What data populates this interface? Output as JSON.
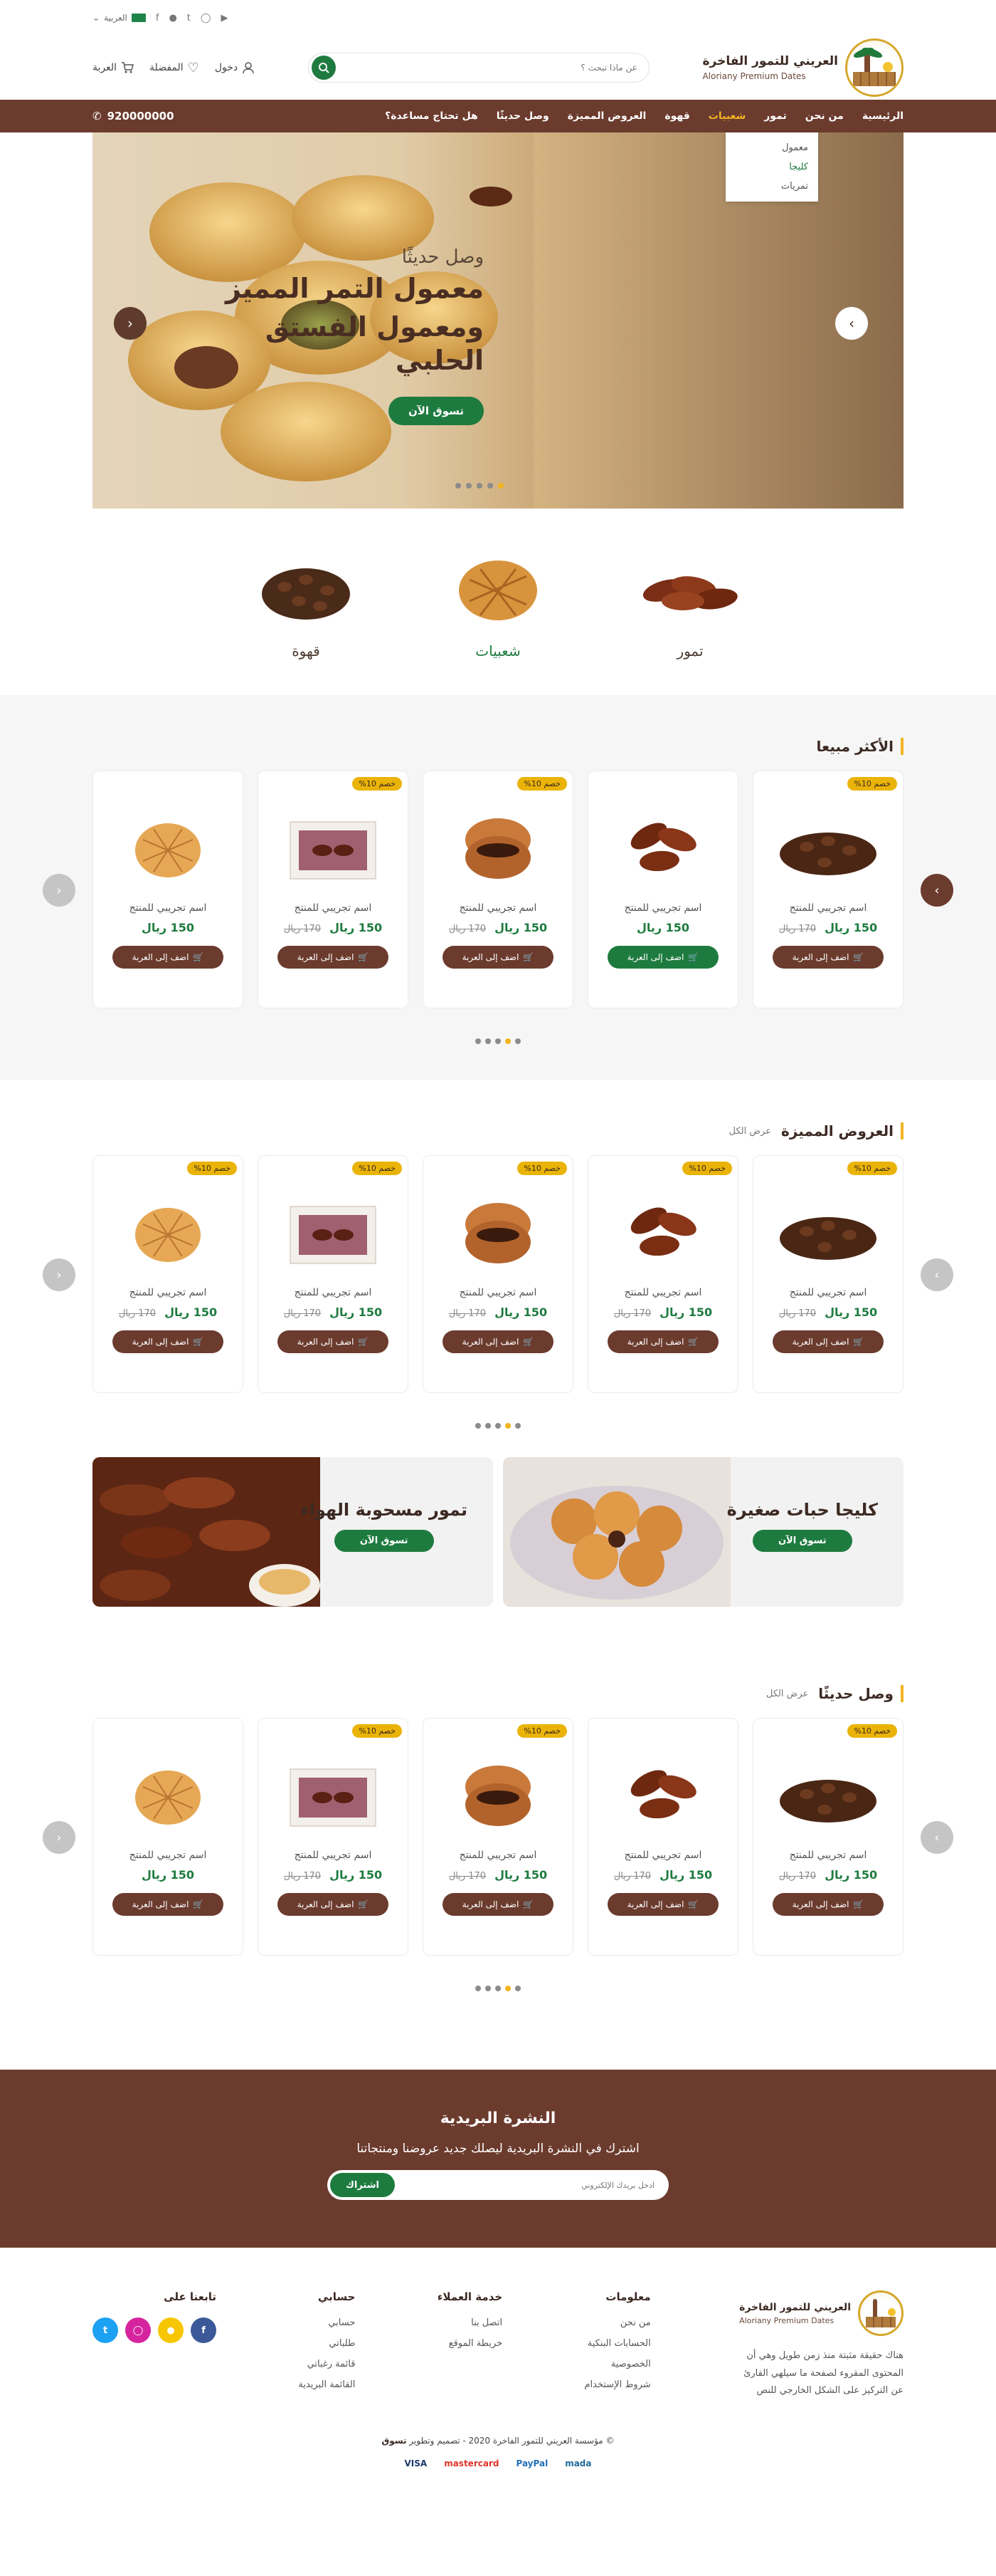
{
  "topbar": {
    "lang": "العربية"
  },
  "header": {
    "brand_ar": "العريني للتمور الفاخرة",
    "brand_en": "Aloriany Premium Dates",
    "search_placeholder": "عن ماذا تبحث ؟",
    "login": "دخول",
    "wishlist": "المفضلة",
    "cart": "العربة"
  },
  "nav": {
    "items": [
      "الرئيسية",
      "من نحن",
      "تمور",
      "شعبيات",
      "قهوة",
      "العروض المميزة",
      "وصل حديثًا",
      "هل تحتاج مساعدة؟"
    ],
    "phone": "920000000",
    "dropdown": [
      "معمول",
      "كليجا",
      "تمريات"
    ]
  },
  "hero": {
    "subtitle": "وصل حديثًا",
    "title_line1": "معمول التمر المميز",
    "title_line2": "ومعمول الفستق الحلبي",
    "cta": "تسوق الآن"
  },
  "categories": [
    "تمور",
    "شعبيات",
    "قهوة"
  ],
  "sections": {
    "best": {
      "title": "الأكثر مبيعا"
    },
    "offers": {
      "title": "العروض المميزة",
      "all": "عرض الكل"
    },
    "new": {
      "title": "وصل حديثًا",
      "all": "عرض الكل"
    }
  },
  "product": {
    "name": "اسم تجريبي للمنتج",
    "price": "150 ريال",
    "old_price": "170 ريال",
    "badge": "خصم 10%",
    "add": "اضف إلى العربة"
  },
  "promos": [
    {
      "title": "كليجا حبات صغيرة",
      "cta": "تسوق الآن"
    },
    {
      "title": "تمور مسحوبة الهواء",
      "cta": "تسوق الآن"
    }
  ],
  "newsletter": {
    "title": "النشرة البريدية",
    "text": "اشترك في النشرة البريدية ليصلك جديد عروضنا ومنتجاتنا",
    "placeholder": "ادخل بريدك الإلكتروني",
    "button": "اشتراك"
  },
  "footer": {
    "about": "هناك حقيقة مثبتة منذ زمن طويل وهي أن المحتوى المقروء لصفحة ما سيلهي القارئ عن التركيز على الشكل الخارجي للنص",
    "info": {
      "title": "معلومات",
      "links": [
        "من نحن",
        "الحسابات البنكية",
        "الخصوصية",
        "شروط الإستخدام"
      ]
    },
    "service": {
      "title": "خدمة العملاء",
      "links": [
        "اتصل بنا",
        "خريطة الموقع"
      ]
    },
    "account": {
      "title": "حسابي",
      "links": [
        "حسابي",
        "طلباتي",
        "قائمة رغباتي",
        "القائمة البريدية"
      ]
    },
    "follow": {
      "title": "تابعنا على"
    },
    "copyright": "© مؤسسة العريني للتمور الفاخرة 2020 - تصميم وتطوير",
    "dev": "تسوق",
    "payments": [
      "mada",
      "PayPal",
      "mastercard",
      "VISA"
    ]
  },
  "colors": {
    "brown": "#6b3b2e",
    "green": "#1e7b3f",
    "gold": "#f2b421"
  }
}
